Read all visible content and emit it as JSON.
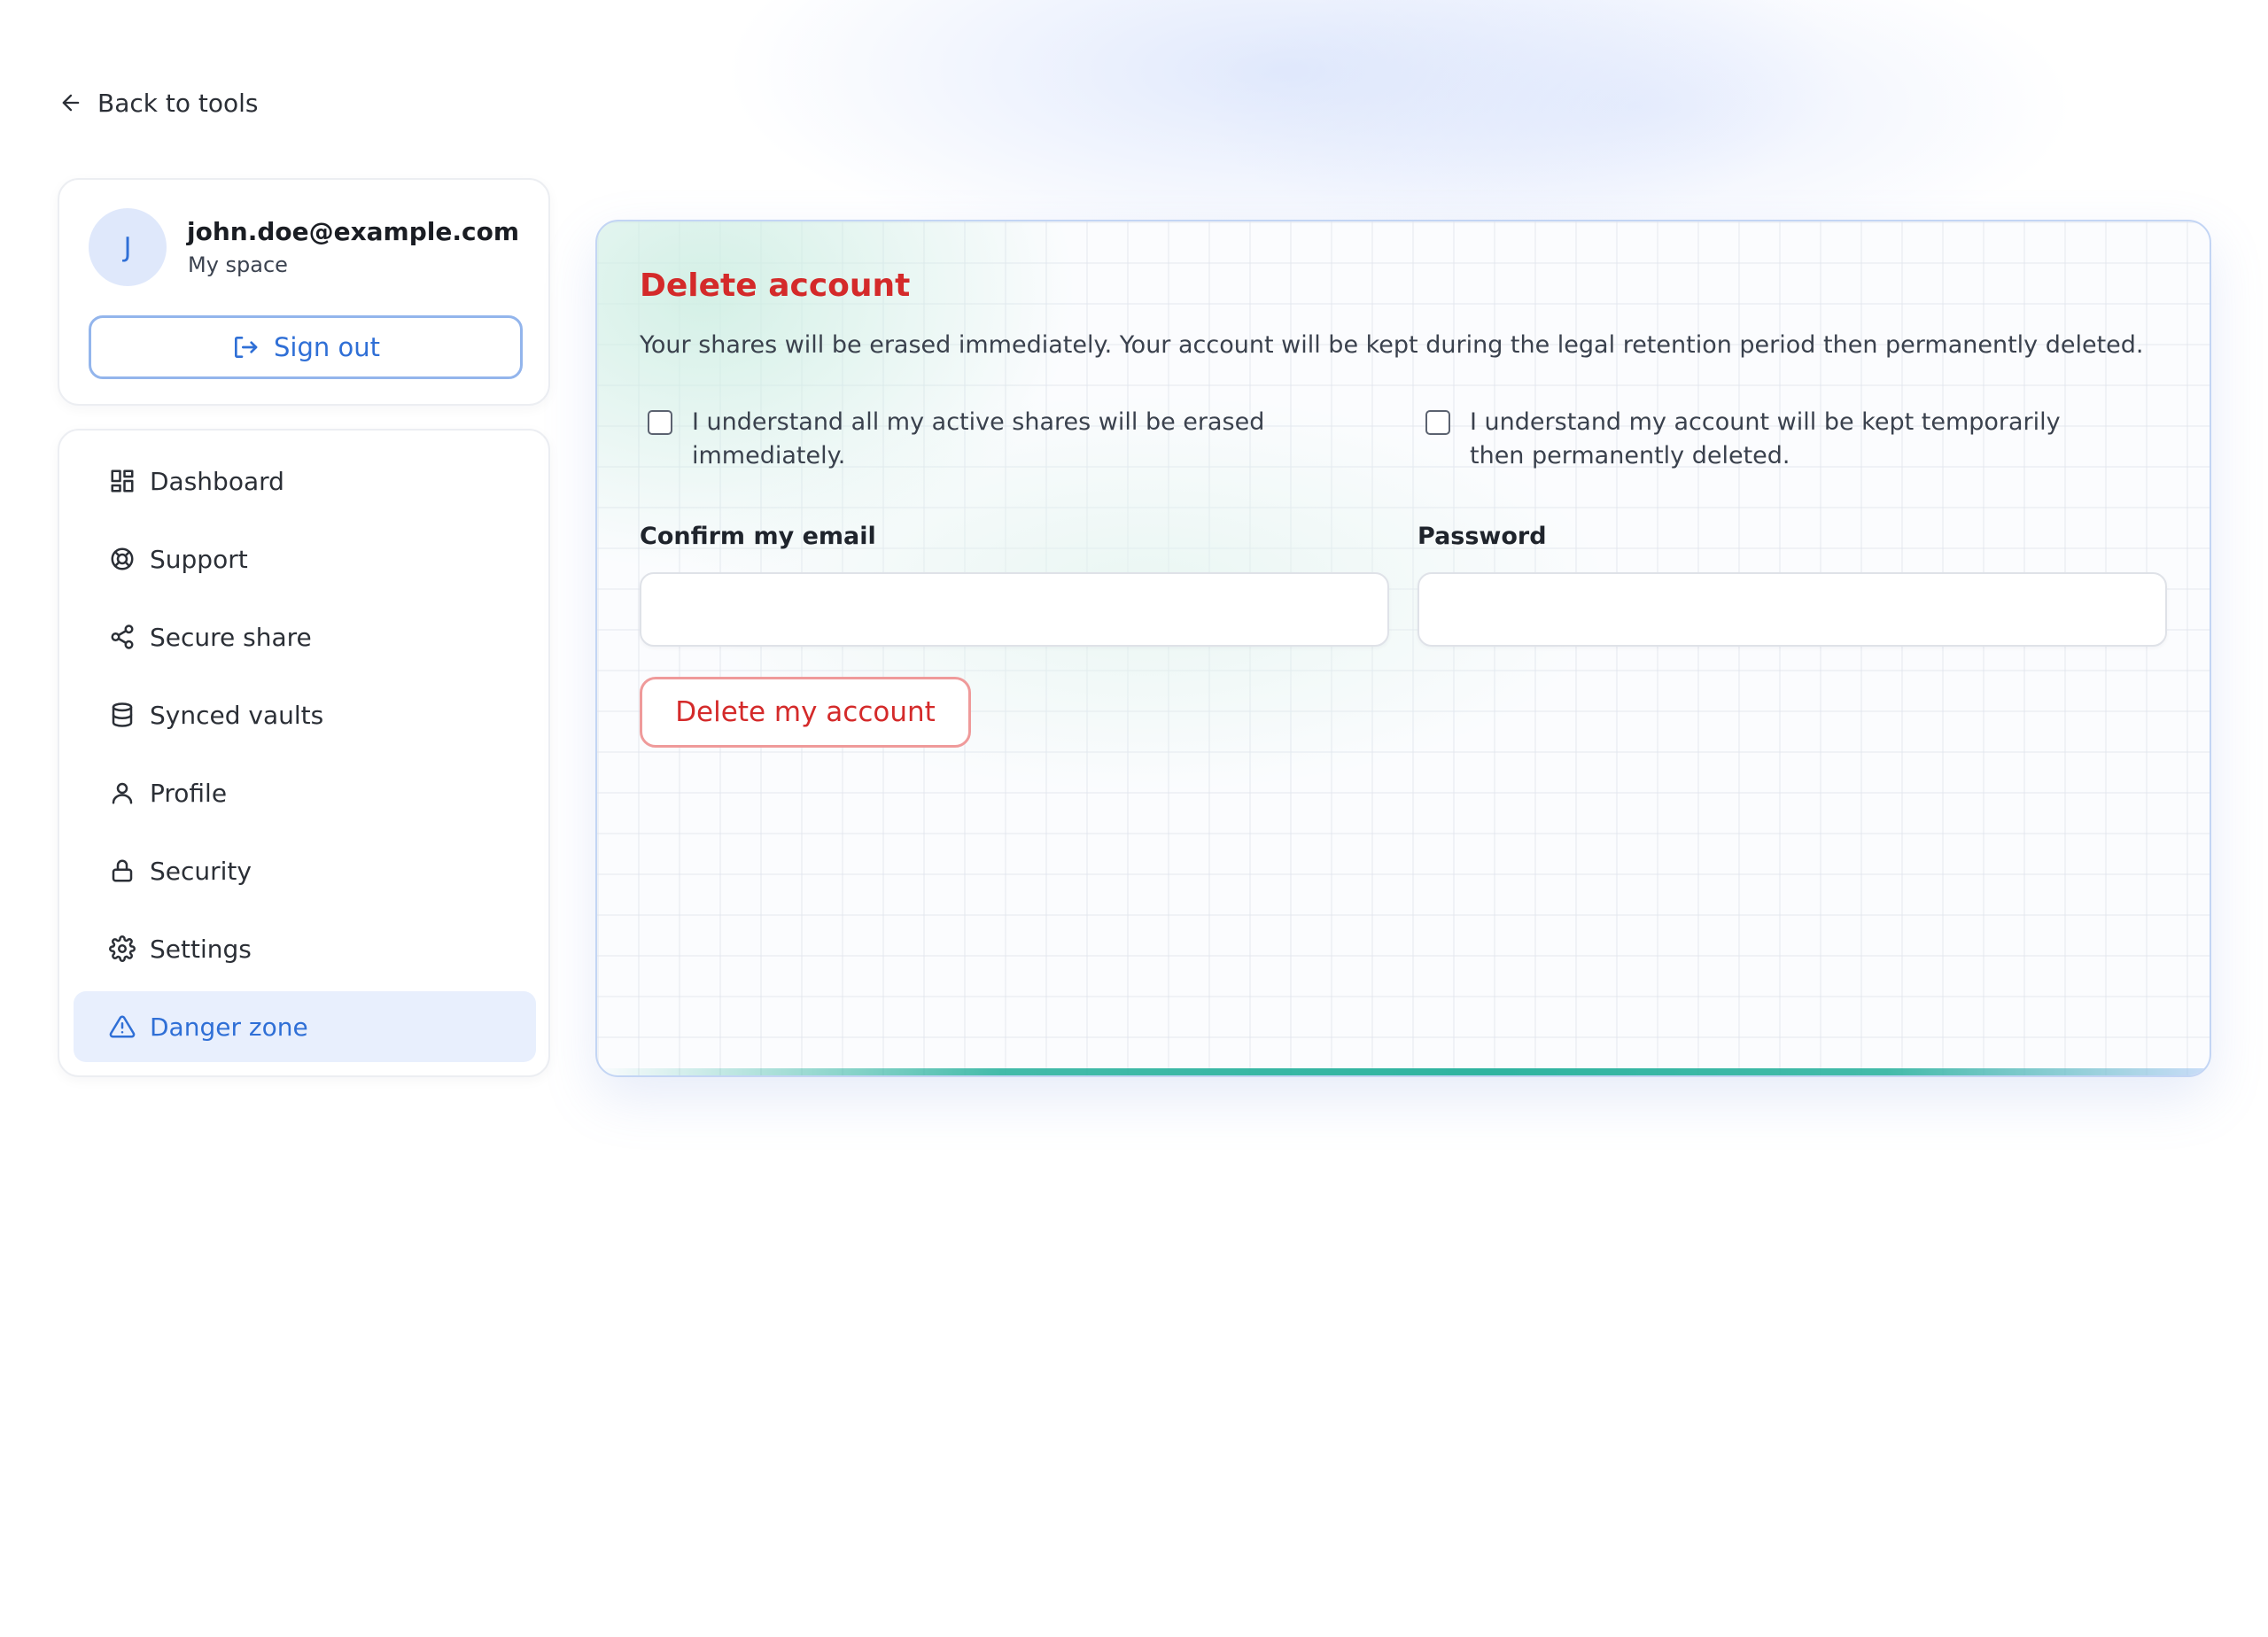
{
  "back_link": {
    "label": "Back to tools",
    "icon": "arrow-left-icon"
  },
  "account": {
    "avatar_initial": "J",
    "email": "john.doe@example.com",
    "space": "My space",
    "signout_label": "Sign out",
    "signout_icon": "sign-out-icon"
  },
  "nav": {
    "items": [
      {
        "label": "Dashboard",
        "icon": "dashboard-icon",
        "active": false
      },
      {
        "label": "Support",
        "icon": "lifebuoy-icon",
        "active": false
      },
      {
        "label": "Secure share",
        "icon": "share-icon",
        "active": false
      },
      {
        "label": "Synced vaults",
        "icon": "database-icon",
        "active": false
      },
      {
        "label": "Profile",
        "icon": "user-icon",
        "active": false
      },
      {
        "label": "Security",
        "icon": "lock-icon",
        "active": false
      },
      {
        "label": "Settings",
        "icon": "gear-icon",
        "active": false
      },
      {
        "label": "Danger zone",
        "icon": "warning-icon",
        "active": true
      }
    ]
  },
  "panel": {
    "title": "Delete account",
    "description": "Your shares will be erased immediately. Your account will be kept during the legal retention period then permanently deleted.",
    "acknowledgements": [
      {
        "label": "I understand all my active shares will be erased immediately.",
        "checked": false
      },
      {
        "label": "I understand my account will be kept temporarily then permanently deleted.",
        "checked": false
      }
    ],
    "email_label": "Confirm my email",
    "email_value": "",
    "password_label": "Password",
    "password_value": "",
    "delete_button": "Delete my account"
  },
  "colors": {
    "accent_blue": "#2f6fd6",
    "danger_red": "#d42a2a",
    "active_nav_bg": "#e8effd",
    "teal_accent": "#2fb4a0"
  }
}
